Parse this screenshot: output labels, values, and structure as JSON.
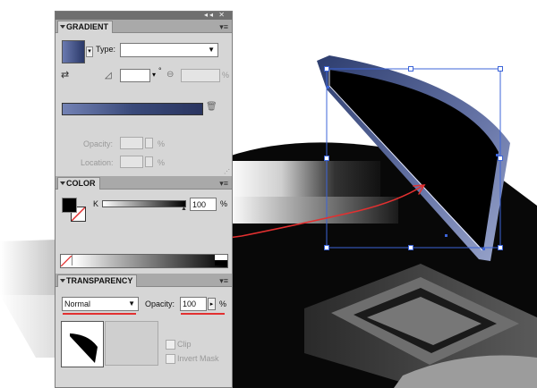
{
  "gradient_panel": {
    "tab_label": "GRADIENT",
    "type_label": "Type:",
    "type_value": "",
    "angle_suffix": "°",
    "aspect_suffix": "%",
    "opacity_label": "Opacity:",
    "opacity_suffix": "%",
    "location_label": "Location:",
    "location_suffix": "%"
  },
  "color_panel": {
    "tab_label": "COLOR",
    "channel_label": "K",
    "channel_value": "100",
    "channel_suffix": "%"
  },
  "transparency_panel": {
    "tab_label": "TRANSPARENCY",
    "blend_mode": "Normal",
    "opacity_label": "Opacity:",
    "opacity_value": "100",
    "opacity_suffix": "%",
    "clip_label": "Clip",
    "invert_mask_label": "Invert Mask"
  },
  "colors": {
    "panel_bg": "#d6d6d6",
    "gradient_swatch": "#4a5a80",
    "selection_blue": "#3c64d8",
    "annotation_red": "#e23030",
    "shape_edge": "#4d5f9a"
  }
}
